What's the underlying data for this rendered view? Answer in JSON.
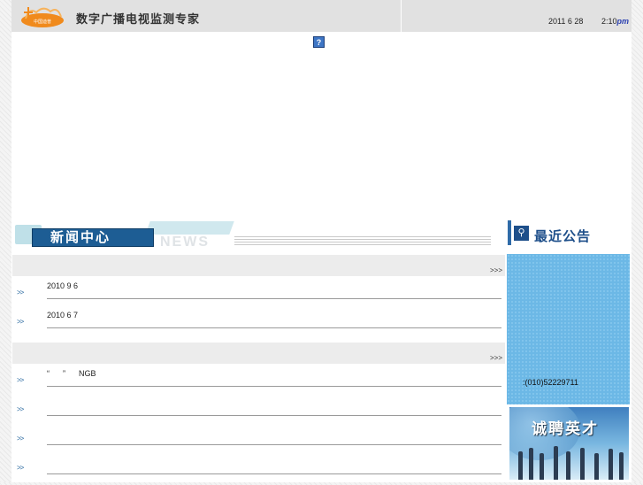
{
  "header": {
    "logo_text": "中国迪普",
    "site_title": "数字广播电视监测专家",
    "date": "2011 6 28",
    "time": "2:10",
    "ampm": "pm",
    "help_icon_glyph": "?"
  },
  "news": {
    "tab_label": "新闻中心",
    "deco_word": "NEWS",
    "sections": [
      {
        "more": ">>>",
        "rows": [
          {
            "bullet": ">>",
            "text": "2010 9 6"
          },
          {
            "bullet": ">>",
            "text": "2010 6 7"
          }
        ]
      },
      {
        "more": ">>>",
        "rows": [
          {
            "bullet": ">>",
            "text": "“      ”      NGB"
          },
          {
            "bullet": ">>",
            "text": ""
          },
          {
            "bullet": ">>",
            "text": ""
          },
          {
            "bullet": ">>",
            "text": ""
          }
        ]
      }
    ]
  },
  "notice": {
    "title": "最近公告",
    "icon": "search-icon",
    "phone": ":(010)52229711"
  },
  "recruit": {
    "text": "诚聘英才"
  },
  "colors": {
    "header_bg": "#e1e1e1",
    "news_tab": "#1d5d94",
    "notice_panel": "#6cb8e6",
    "accent_blue": "#1e4f8a"
  }
}
